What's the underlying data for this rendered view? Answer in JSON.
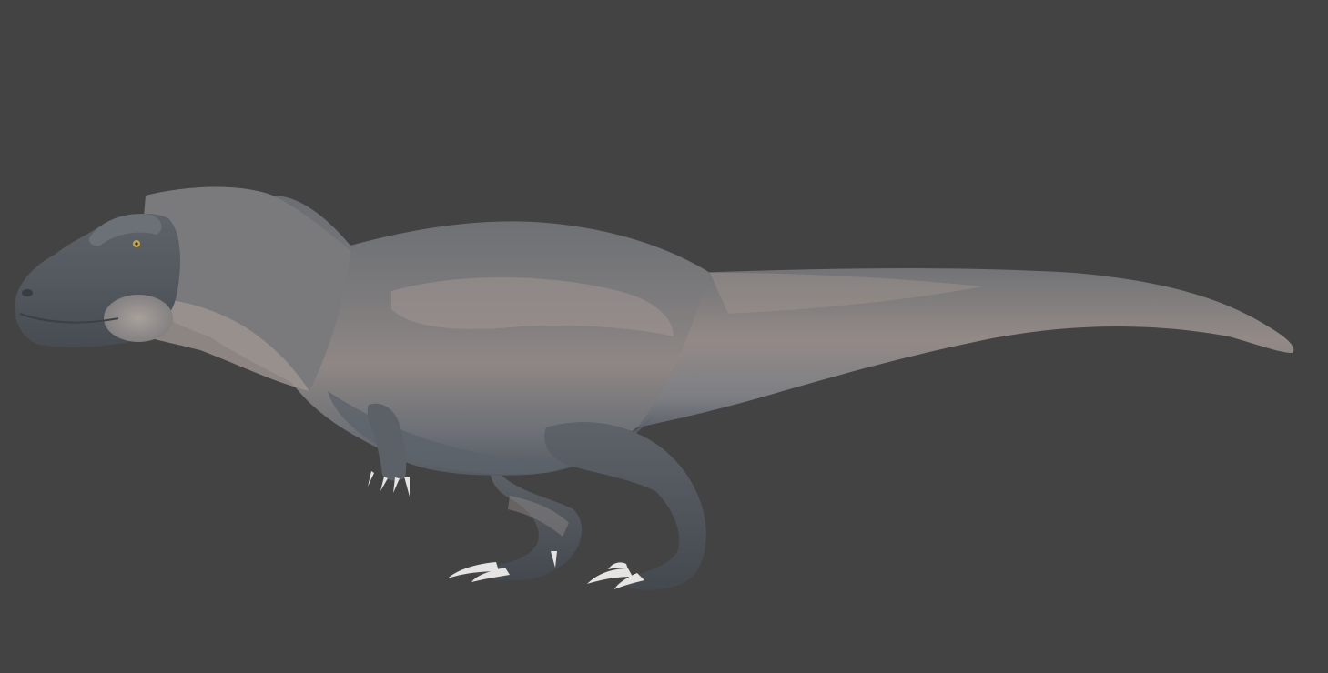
{
  "scene": {
    "background_color": "#434343",
    "subject": "theropod-dinosaur-render",
    "colors": {
      "body_light": "#8e8a89",
      "body_mid": "#6f7174",
      "body_dark": "#4a4f55",
      "flank_warm": "#a59a95",
      "legs": "#50565c",
      "claws": "#e6e4e2",
      "eye": "#c9a640"
    }
  }
}
